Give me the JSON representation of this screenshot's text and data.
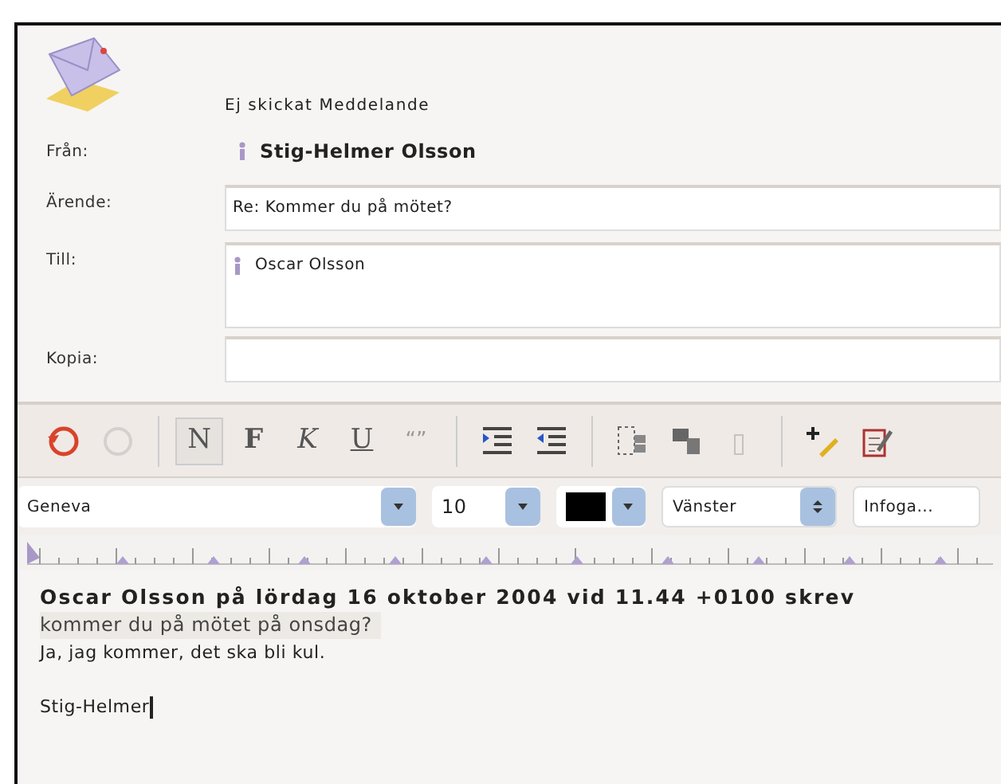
{
  "window": {
    "title": "Ej skickat Meddelande"
  },
  "header": {
    "from_label": "Från:",
    "from": "Stig-Helmer Olsson",
    "subject_label": "Ärende:",
    "subject": "Re: Kommer du på mötet?",
    "to_label": "Till:",
    "to": [
      {
        "name": "Oscar Olsson"
      }
    ],
    "cc_label": "Kopia:"
  },
  "toolbar": [
    {
      "kind": "icon",
      "disabled": false,
      "selected": false
    },
    {
      "kind": "icon",
      "disabled": true,
      "selected": false
    },
    {
      "kind": "sep"
    },
    {
      "kind": "text",
      "label": "N",
      "disabled": false,
      "selected": true
    },
    {
      "kind": "text",
      "label": "F",
      "disabled": false,
      "selected": false
    },
    {
      "kind": "text",
      "label": "K",
      "disabled": false,
      "selected": false
    },
    {
      "kind": "text",
      "label": "U",
      "disabled": false,
      "selected": false
    },
    {
      "kind": "text",
      "label": "“”",
      "disabled": true,
      "selected": false
    },
    {
      "kind": "sep"
    },
    {
      "kind": "icon",
      "disabled": false,
      "selected": false
    },
    {
      "kind": "icon",
      "disabled": false,
      "selected": false
    },
    {
      "kind": "sep"
    },
    {
      "kind": "icon",
      "disabled": false,
      "selected": false
    },
    {
      "kind": "icon",
      "disabled": false,
      "selected": false
    },
    {
      "kind": "icon",
      "disabled": true,
      "selected": false
    },
    {
      "kind": "sep"
    },
    {
      "kind": "icon",
      "disabled": false,
      "selected": false
    },
    {
      "kind": "icon",
      "disabled": false,
      "selected": false
    }
  ],
  "format_bar": {
    "font": "Geneva",
    "size": "10",
    "align": "Vänster",
    "insert": "Infoga..."
  },
  "body": [
    {
      "kind": "attribution",
      "text": "Oscar Olsson på lördag 16 oktober 2004 vid 11.44 +0100 skrev"
    },
    {
      "kind": "quote",
      "text": "kommer du på mötet på onsdag?"
    },
    {
      "kind": "plain",
      "text": "Ja, jag kommer, det ska bli kul."
    },
    {
      "kind": "blank"
    },
    {
      "kind": "plain",
      "text": "Stig-Helmer",
      "cursor": true
    }
  ]
}
